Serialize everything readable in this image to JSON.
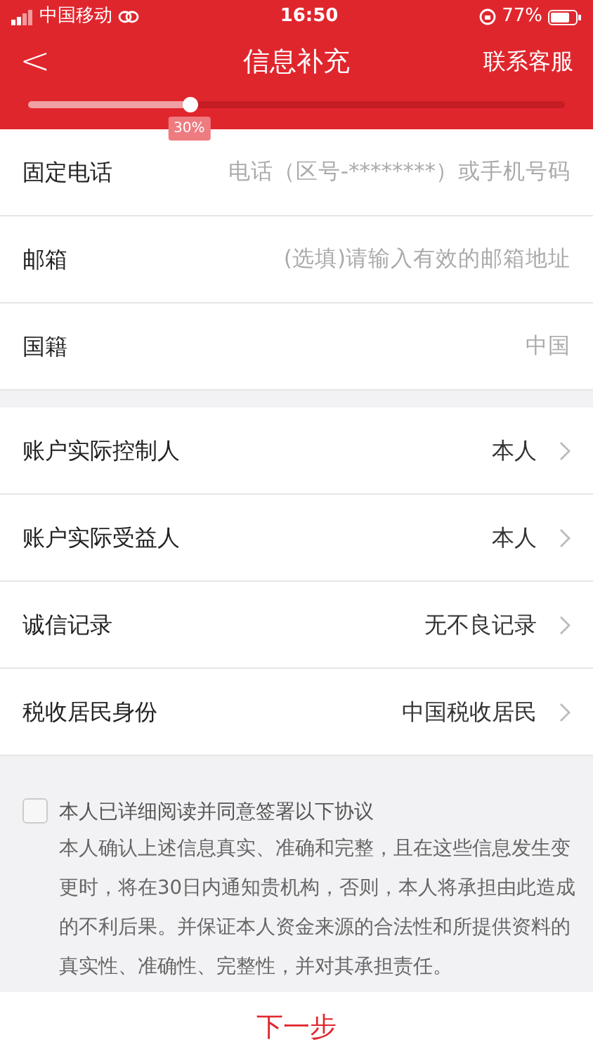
{
  "status_bar": {
    "carrier": "中国移动",
    "time": "16:50",
    "battery": "77%"
  },
  "nav": {
    "back": "<",
    "title": "信息补充",
    "action": "联系客服"
  },
  "progress": {
    "level": 0.3,
    "label": "30%"
  },
  "groups": [
    {
      "rows": [
        {
          "kind": "input",
          "label": "固定电话",
          "placeholder": "电话（区号-********）或手机号码"
        },
        {
          "kind": "input",
          "label": "邮箱",
          "placeholder": "(选填)请输入有效的邮箱地址"
        },
        {
          "kind": "input",
          "label": "国籍",
          "value": "中国",
          "disabled": true
        }
      ]
    },
    {
      "rows": [
        {
          "kind": "select",
          "label": "账户实际控制人",
          "value": "本人"
        },
        {
          "kind": "select",
          "label": "账户实际受益人",
          "value": "本人"
        },
        {
          "kind": "select",
          "label": "诚信记录",
          "value": "无不良记录"
        },
        {
          "kind": "select",
          "label": "税收居民身份",
          "value": "中国税收居民"
        }
      ]
    }
  ],
  "agreement": {
    "checked": false,
    "title": "本人已详细阅读并同意签署以下协议",
    "text": "本人确认上述信息真实、准确和完整，且在这些信息发生变更时，将在30日内通知贵机构，否则，本人将承担由此造成的不利后果。并保证本人资金来源的合法性和所提供资料的真实性、准确性、完整性，并对其承担责任。"
  },
  "next_button": "下一步"
}
